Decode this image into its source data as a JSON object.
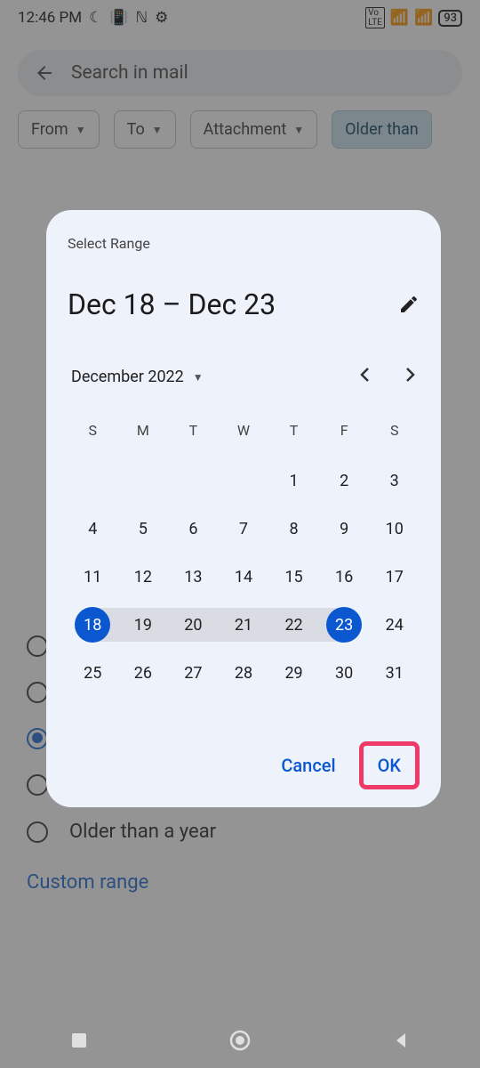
{
  "status": {
    "time": "12:46 PM",
    "battery": "93"
  },
  "search": {
    "placeholder": "Search in mail"
  },
  "chips": {
    "from": "From",
    "to": "To",
    "attachment": "Attachment",
    "older": "Older than"
  },
  "options": {
    "year": "Older than a year",
    "custom": "Custom range"
  },
  "dialog": {
    "title": "Select Range",
    "range": "Dec 18 – Dec 23",
    "month": "December 2022",
    "dow": [
      "S",
      "M",
      "T",
      "W",
      "T",
      "F",
      "S"
    ],
    "weeks": [
      [
        "",
        "",
        "",
        "",
        "1",
        "2",
        "3"
      ],
      [
        "4",
        "5",
        "6",
        "7",
        "8",
        "9",
        "10"
      ],
      [
        "11",
        "12",
        "13",
        "14",
        "15",
        "16",
        "17"
      ],
      [
        "18",
        "19",
        "20",
        "21",
        "22",
        "23",
        "24"
      ],
      [
        "25",
        "26",
        "27",
        "28",
        "29",
        "30",
        "31"
      ]
    ],
    "range_start": "18",
    "range_end": "23",
    "cancel": "Cancel",
    "ok": "OK"
  }
}
